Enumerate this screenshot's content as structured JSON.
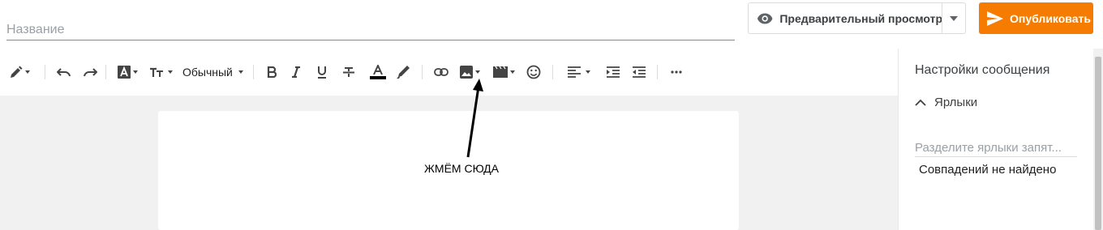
{
  "title_field": {
    "placeholder": "Название",
    "value": ""
  },
  "header": {
    "preview_label": "Предварительный просмотр",
    "publish_label": "Опубликовать"
  },
  "toolbar": {
    "paragraph_format": "Обычный",
    "items": [
      "pencil-icon",
      "undo-icon",
      "redo-icon",
      "font-icon",
      "text-size-icon",
      "bold-icon",
      "italic-icon",
      "underline-icon",
      "strikethrough-icon",
      "text-color-icon",
      "highlight-icon",
      "link-icon",
      "image-icon",
      "video-icon",
      "emoji-icon",
      "align-icon",
      "indent-icon",
      "outdent-icon",
      "more-icon"
    ]
  },
  "annotation": {
    "text": "ЖМЁМ СЮДА"
  },
  "settings": {
    "title": "Настройки сообщения",
    "labels_section": "Ярлыки",
    "labels_placeholder": "Разделите ярлыки запят...",
    "no_match": "Совпадений не найдено"
  },
  "colors": {
    "accent": "#f57c00",
    "underline": "#e8710a",
    "editor_bg": "#f1f1f1"
  }
}
